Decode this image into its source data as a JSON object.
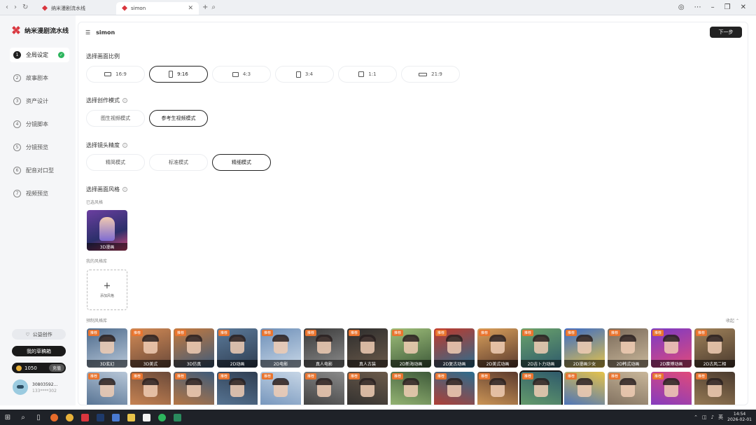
{
  "browser": {
    "tabs": [
      {
        "title": "纳米漫剧流水线"
      },
      {
        "title": "simon"
      }
    ]
  },
  "sidebar": {
    "brand": "纳米漫剧流水线",
    "steps": [
      {
        "num": "1",
        "label": "全局设定",
        "active": true
      },
      {
        "num": "2",
        "label": "故事剧本"
      },
      {
        "num": "3",
        "label": "资产设计"
      },
      {
        "num": "4",
        "label": "分镜脚本"
      },
      {
        "num": "5",
        "label": "分镜预览"
      },
      {
        "num": "6",
        "label": "配音对口型"
      },
      {
        "num": "7",
        "label": "视频预览"
      }
    ],
    "fav_button": "公益创作",
    "dark_button": "我的草稿箱",
    "credits": "1050",
    "credits_tag": "充值",
    "user": {
      "name": "30803592...",
      "phone": "133****302"
    }
  },
  "main": {
    "header_title": "simon",
    "next_button": "下一步",
    "ratio_section": {
      "title": "选择画面比例",
      "options": [
        "16:9",
        "9:16",
        "4:3",
        "3:4",
        "1:1",
        "21:9"
      ],
      "selected": "9:16"
    },
    "mode_section": {
      "title": "选择创作模式",
      "options": [
        "图生视频模式",
        "参考生视频模式"
      ],
      "selected": "参考生视频模式"
    },
    "precision_section": {
      "title": "选择镜头精度",
      "options": [
        "精简模式",
        "标准模式",
        "精细模式"
      ],
      "selected": "精细模式"
    },
    "style_section": {
      "title": "选择画面风格",
      "selected_label": "已选风格",
      "selected_style": "3D漫画",
      "custom_label": "我的风格库",
      "add_label": "添加风格",
      "preset_label": "预制风格库",
      "more": "收起",
      "badge": "推荐",
      "row1": [
        "3D玄幻",
        "3D美式",
        "3D仿真",
        "2D动画",
        "2D电影",
        "真人电影",
        "真人古装",
        "2D新海动画",
        "2D复古动画",
        "2D美式动画",
        "2D吉卜力动画",
        "2D漫画少女",
        "2D韩式动画",
        "2D赛博动画",
        "2D古风二相"
      ],
      "row2": [
        "",
        "",
        "",
        "",
        "",
        "",
        "",
        "",
        "",
        "",
        "",
        "",
        "",
        "",
        ""
      ],
      "row2_badge": "推荐"
    }
  },
  "taskbar": {
    "time": "14:54",
    "date": "2026-02-01",
    "lang": "英"
  }
}
